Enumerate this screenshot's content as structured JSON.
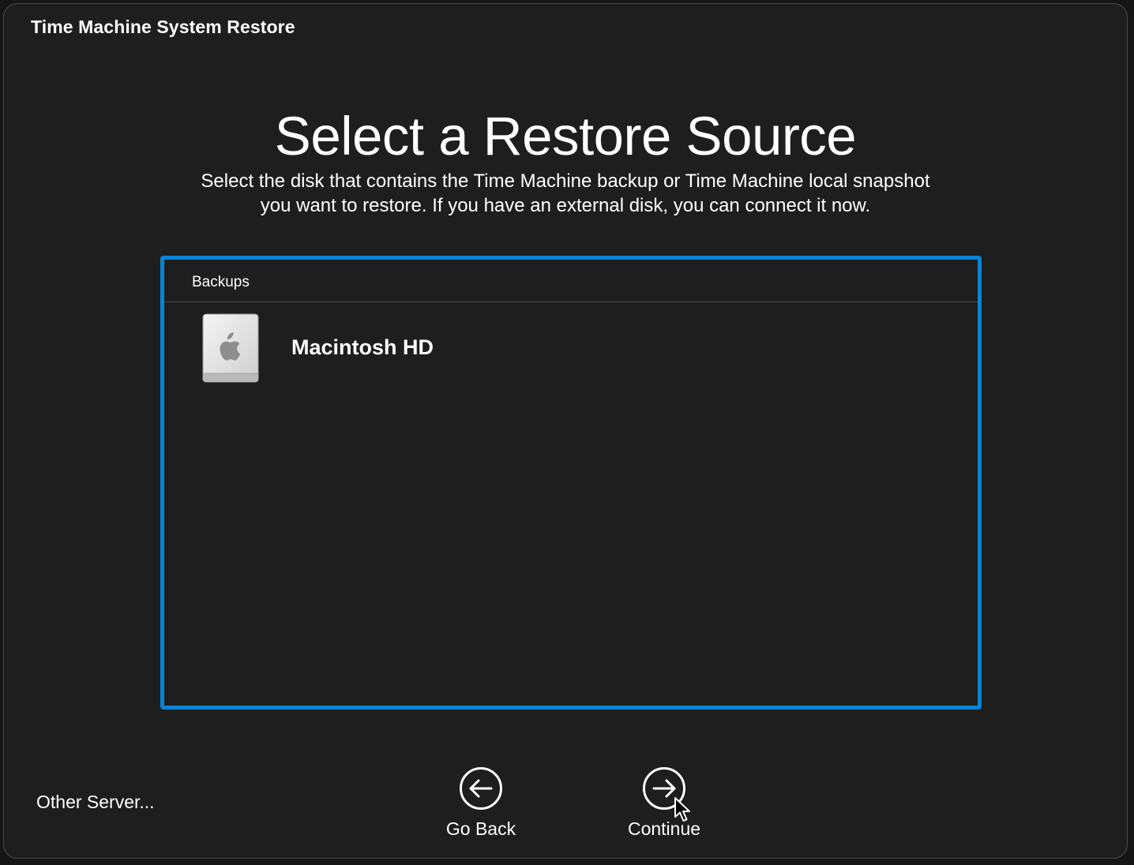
{
  "window": {
    "title": "Time Machine System Restore"
  },
  "main": {
    "title": "Select a Restore Source",
    "subtitle_line1": "Select the disk that contains the Time Machine backup or Time Machine local snapshot",
    "subtitle_line2": "you want to restore. If you have an external disk, you can connect it now."
  },
  "backups_list": {
    "header": "Backups",
    "items": [
      {
        "label": "Macintosh HD",
        "icon": "internal-disk-icon"
      }
    ]
  },
  "footer": {
    "other_server_label": "Other Server...",
    "go_back_label": "Go Back",
    "go_back_icon": "arrow-left-circle-icon",
    "continue_label": "Continue",
    "continue_icon": "arrow-right-circle-icon"
  },
  "colors": {
    "background": "#1e1e1e",
    "focus_ring": "#0a84d6",
    "text": "#ffffff"
  }
}
